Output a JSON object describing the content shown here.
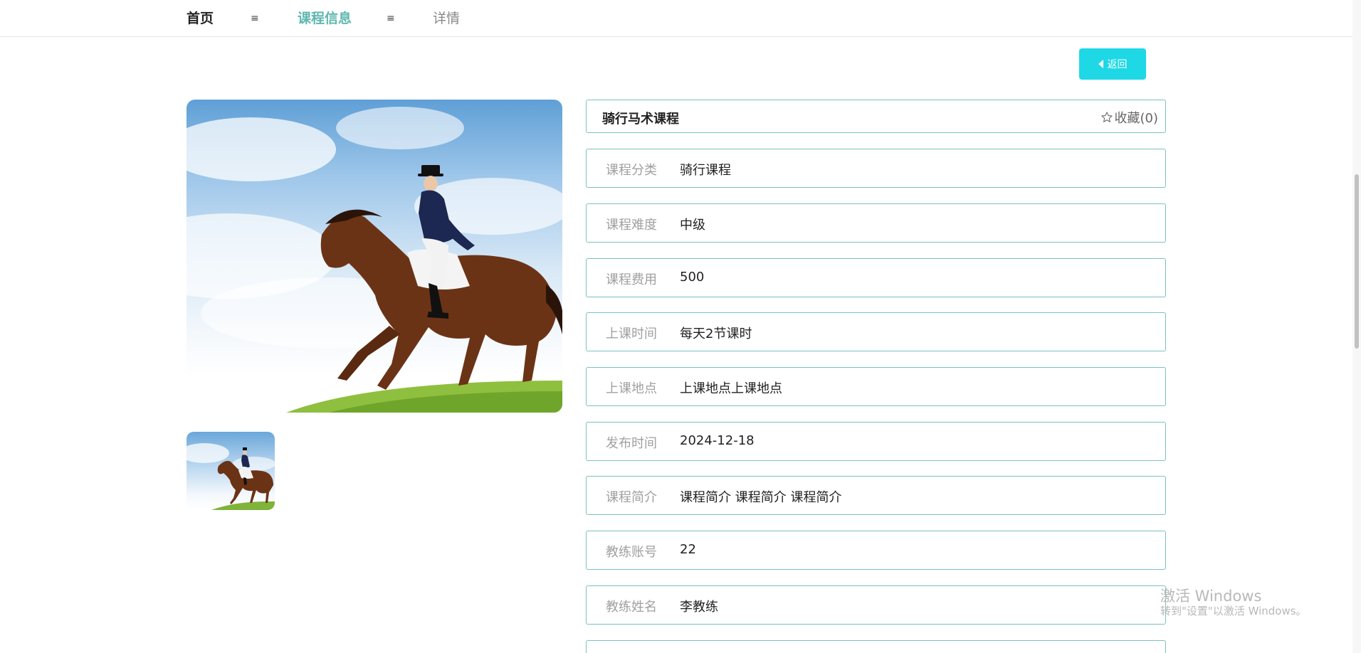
{
  "breadcrumb": {
    "home": "首页",
    "separator": "≡",
    "current": "课程信息",
    "detail": "详情"
  },
  "back_button": {
    "label": "返回"
  },
  "course": {
    "name": "骑行马术课程",
    "favorite_label": "收藏(0)"
  },
  "fields": [
    {
      "label": "课程分类",
      "value": "骑行课程"
    },
    {
      "label": "课程难度",
      "value": "中级"
    },
    {
      "label": "课程费用",
      "value": "500"
    },
    {
      "label": "上课时间",
      "value": "每天2节课时"
    },
    {
      "label": "上课地点",
      "value": "上课地点上课地点"
    },
    {
      "label": "发布时间",
      "value": "2024-12-18"
    },
    {
      "label": "课程简介",
      "value": "课程简介 课程简介 课程简介"
    },
    {
      "label": "教练账号",
      "value": "22"
    },
    {
      "label": "教练姓名",
      "value": "李教练"
    }
  ],
  "watermark": {
    "line1": "激活 Windows",
    "line2": "转到\"设置\"以激活 Windows。"
  },
  "colors": {
    "accent": "#5fb7b0",
    "border": "#7cc1bd",
    "button": "#1fd8e6"
  }
}
